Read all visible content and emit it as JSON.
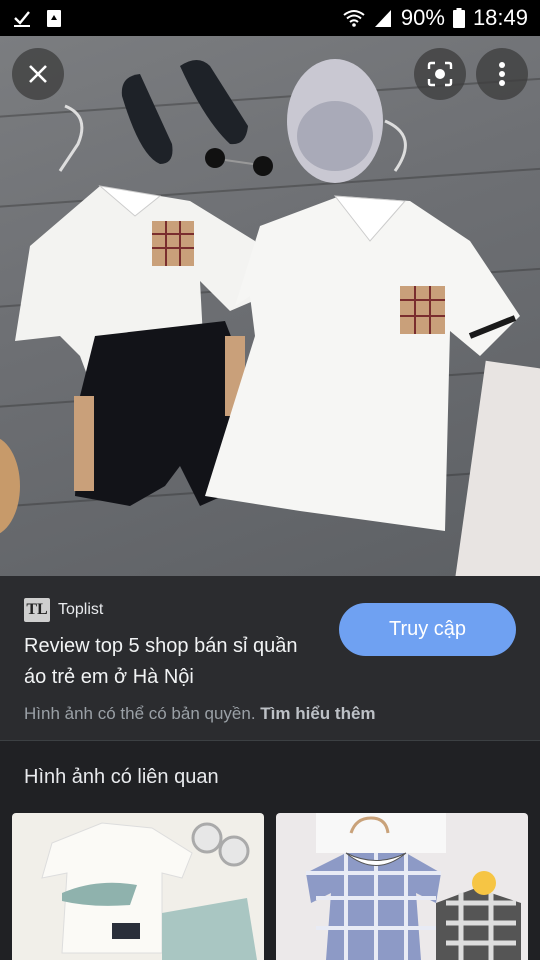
{
  "status_bar": {
    "battery": "90%",
    "time": "18:49"
  },
  "image_viewer": {
    "close_icon": "close-icon",
    "lens_icon": "lens-icon",
    "more_icon": "more-vert-icon"
  },
  "result": {
    "source": "Toplist",
    "source_logo": "TL",
    "title": "Review top 5 shop bán sỉ quần áo trẻ em ở Hà Nội",
    "visit_label": "Truy cập",
    "copyright_text": "Hình ảnh có thể có bản quyền.",
    "learn_more": "Tìm hiểu thêm"
  },
  "related": {
    "title": "Hình ảnh có liên quan"
  }
}
